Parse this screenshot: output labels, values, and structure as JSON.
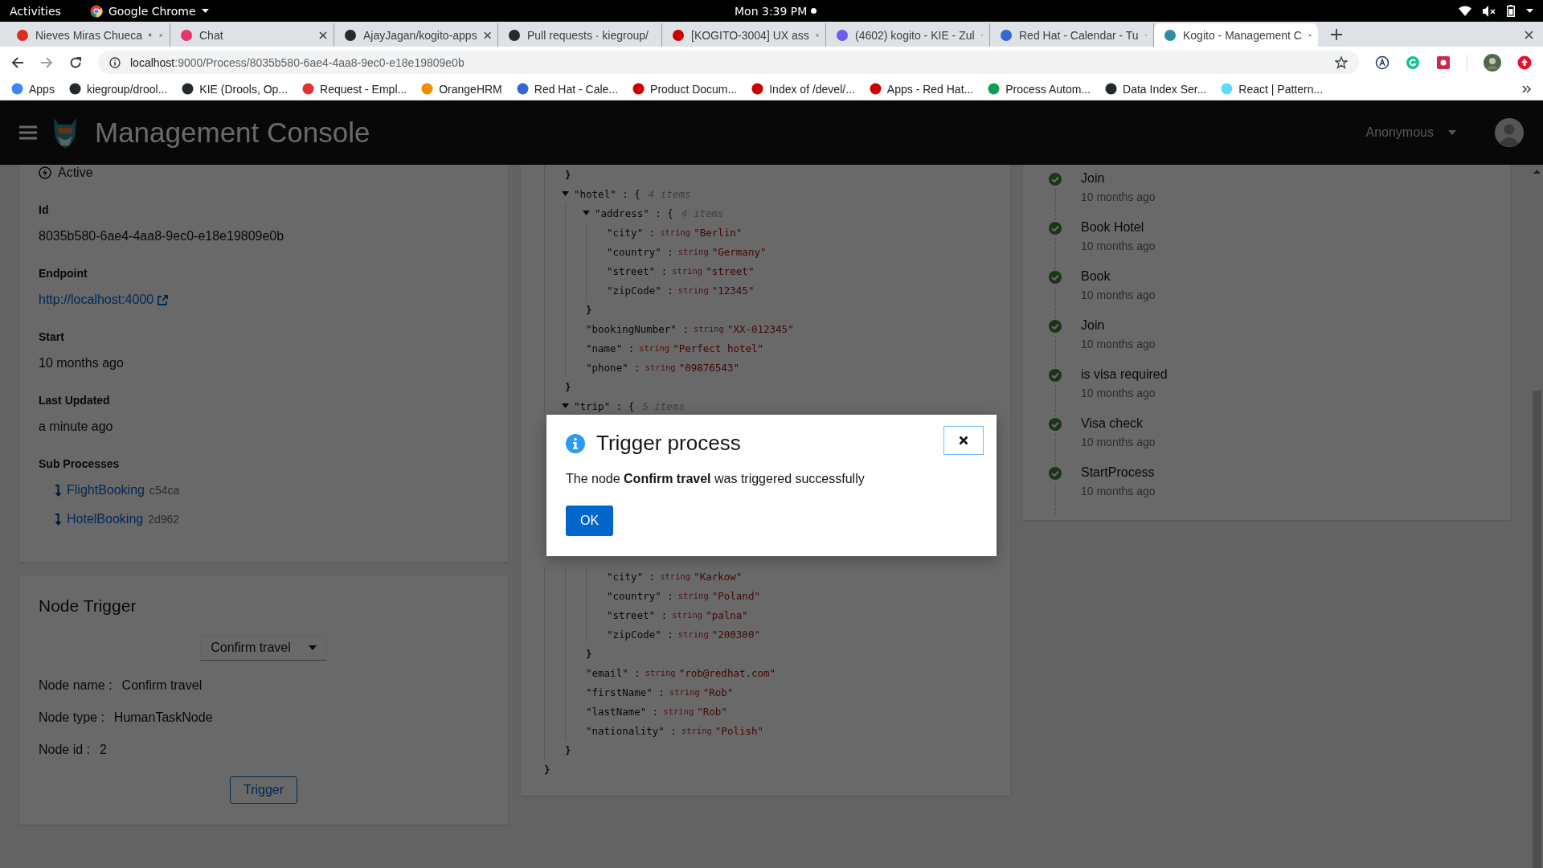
{
  "system_bar": {
    "activities": "Activities",
    "app": "Google Chrome",
    "clock": "Mon 3:39 PM"
  },
  "tabs": [
    {
      "title": "Nieves Miras Chueca",
      "selected": false,
      "audio": true,
      "color": "#d93025"
    },
    {
      "title": "Chat",
      "selected": false,
      "audio": false,
      "color": "#e8336d"
    },
    {
      "title": "AjayJagan/kogito-apps",
      "selected": false,
      "audio": false,
      "color": "#24292e"
    },
    {
      "title": "Pull requests · kiegroup/",
      "selected": false,
      "audio": false,
      "color": "#24292e"
    },
    {
      "title": "[KOGITO-3004] UX ass",
      "selected": false,
      "audio": false,
      "color": "#cc0000"
    },
    {
      "title": "(4602) kogito - KIE - Zul",
      "selected": false,
      "audio": false,
      "color": "#6c5ce7"
    },
    {
      "title": "Red Hat - Calendar - Tu",
      "selected": false,
      "audio": false,
      "color": "#3367d6"
    },
    {
      "title": "Kogito - Management C",
      "selected": true,
      "audio": false,
      "color": "#2b8fa3"
    }
  ],
  "address": {
    "host": "localhost",
    "path": ":9000/Process/8035b580-6ae4-4aa8-9ec0-e18e19809e0b"
  },
  "bookmarks": [
    {
      "label": "Apps",
      "color": "#4285f4"
    },
    {
      "label": "kiegroup/drool...",
      "color": "#24292e"
    },
    {
      "label": "KIE (Drools, Op...",
      "color": "#24292e"
    },
    {
      "label": "Request - Empl...",
      "color": "#e03131"
    },
    {
      "label": "OrangeHRM",
      "color": "#f08c00"
    },
    {
      "label": "Red Hat - Cale...",
      "color": "#3367d6"
    },
    {
      "label": "Product Docum...",
      "color": "#cc0000"
    },
    {
      "label": "Index of /devel/...",
      "color": "#cc0000"
    },
    {
      "label": "Apps - Red Hat...",
      "color": "#cc0000"
    },
    {
      "label": "Process Autom...",
      "color": "#0f9d58"
    },
    {
      "label": "Data Index Ser...",
      "color": "#24292e"
    },
    {
      "label": "React | Pattern...",
      "color": "#61dafb"
    }
  ],
  "header": {
    "title": "Management Console",
    "user": "Anonymous"
  },
  "details": {
    "state": "Active",
    "fields": [
      {
        "label": "Id",
        "value": "8035b580-6ae4-4aa8-9ec0-e18e19809e0b",
        "kind": "text"
      },
      {
        "label": "Endpoint",
        "value": "http://localhost:4000",
        "kind": "link"
      },
      {
        "label": "Start",
        "value": "10 months ago",
        "kind": "text"
      },
      {
        "label": "Last Updated",
        "value": "a minute ago",
        "kind": "text"
      }
    ],
    "sub_processes_label": "Sub Processes",
    "sub_processes": [
      {
        "name": "FlightBooking",
        "id": "c54ca"
      },
      {
        "name": "HotelBooking",
        "id": "2d962"
      }
    ]
  },
  "node_trigger": {
    "title": "Node Trigger",
    "dropdown": "Confirm travel",
    "rows": [
      {
        "label": "Node name :",
        "value": "Confirm travel"
      },
      {
        "label": "Node type :",
        "value": "HumanTaskNode"
      },
      {
        "label": "Node id :",
        "value": "2"
      }
    ],
    "button": "Trigger"
  },
  "json_view": {
    "kind": "continued",
    "close": "}",
    "children": [
      {
        "kind": "close",
        "text": "}"
      },
      {
        "kind": "object",
        "key": "\"hotel\" : {",
        "count": "4 items",
        "expanded": true,
        "close": "}",
        "children": [
          {
            "kind": "object",
            "key": "\"address\" : {",
            "count": "4 items",
            "expanded": true,
            "close": "}",
            "children": [
              {
                "kind": "leaf",
                "key": "\"city\" :",
                "type": "string",
                "value": "\"Berlin\""
              },
              {
                "kind": "leaf",
                "key": "\"country\" :",
                "type": "string",
                "value": "\"Germany\""
              },
              {
                "kind": "leaf",
                "key": "\"street\" :",
                "type": "string",
                "value": "\"street\""
              },
              {
                "kind": "leaf",
                "key": "\"zipCode\" :",
                "type": "string",
                "value": "\"12345\""
              }
            ]
          },
          {
            "kind": "leaf",
            "key": "\"bookingNumber\" :",
            "type": "string",
            "value": "\"XX-012345\""
          },
          {
            "kind": "leaf",
            "key": "\"name\" :",
            "type": "string",
            "value": "\"Perfect hotel\""
          },
          {
            "kind": "leaf",
            "key": "\"phone\" :",
            "type": "string",
            "value": "\"09876543\""
          }
        ]
      },
      {
        "kind": "object",
        "key": "\"trip\" : {",
        "count": "5 items",
        "expanded": true
      },
      {
        "kind": "continued",
        "close": "}",
        "children": [
          {
            "kind": "continued",
            "close": "}",
            "children": [
              {
                "kind": "leaf",
                "key": "\"city\" :",
                "type": "string",
                "value": "\"Karkow\""
              },
              {
                "kind": "leaf",
                "key": "\"country\" :",
                "type": "string",
                "value": "\"Poland\""
              },
              {
                "kind": "leaf",
                "key": "\"street\" :",
                "type": "string",
                "value": "\"palna\""
              },
              {
                "kind": "leaf",
                "key": "\"zipCode\" :",
                "type": "string",
                "value": "\"200300\""
              }
            ]
          },
          {
            "kind": "leaf",
            "key": "\"email\" :",
            "type": "string",
            "value": "\"rob@redhat.com\""
          },
          {
            "kind": "leaf",
            "key": "\"firstName\" :",
            "type": "string",
            "value": "\"Rob\""
          },
          {
            "kind": "leaf",
            "key": "\"lastName\" :",
            "type": "string",
            "value": "\"Rob\""
          },
          {
            "kind": "leaf",
            "key": "\"nationality\" :",
            "type": "string",
            "value": "\"Polish\""
          }
        ]
      }
    ]
  },
  "timeline": [
    {
      "name": "Join",
      "time": "10 months ago",
      "done": true
    },
    {
      "name": "Book Hotel",
      "time": "10 months ago",
      "done": true
    },
    {
      "name": "Book",
      "time": "10 months ago",
      "done": true
    },
    {
      "name": "Join",
      "time": "10 months ago",
      "done": true
    },
    {
      "name": "is visa required",
      "time": "10 months ago",
      "done": true
    },
    {
      "name": "Visa check",
      "time": "10 months ago",
      "done": true
    },
    {
      "name": "StartProcess",
      "time": "10 months ago",
      "done": true
    }
  ],
  "modal": {
    "title": "Trigger process",
    "message": "The node **Confirm travel** was triggered successfully",
    "ok": "OK"
  }
}
